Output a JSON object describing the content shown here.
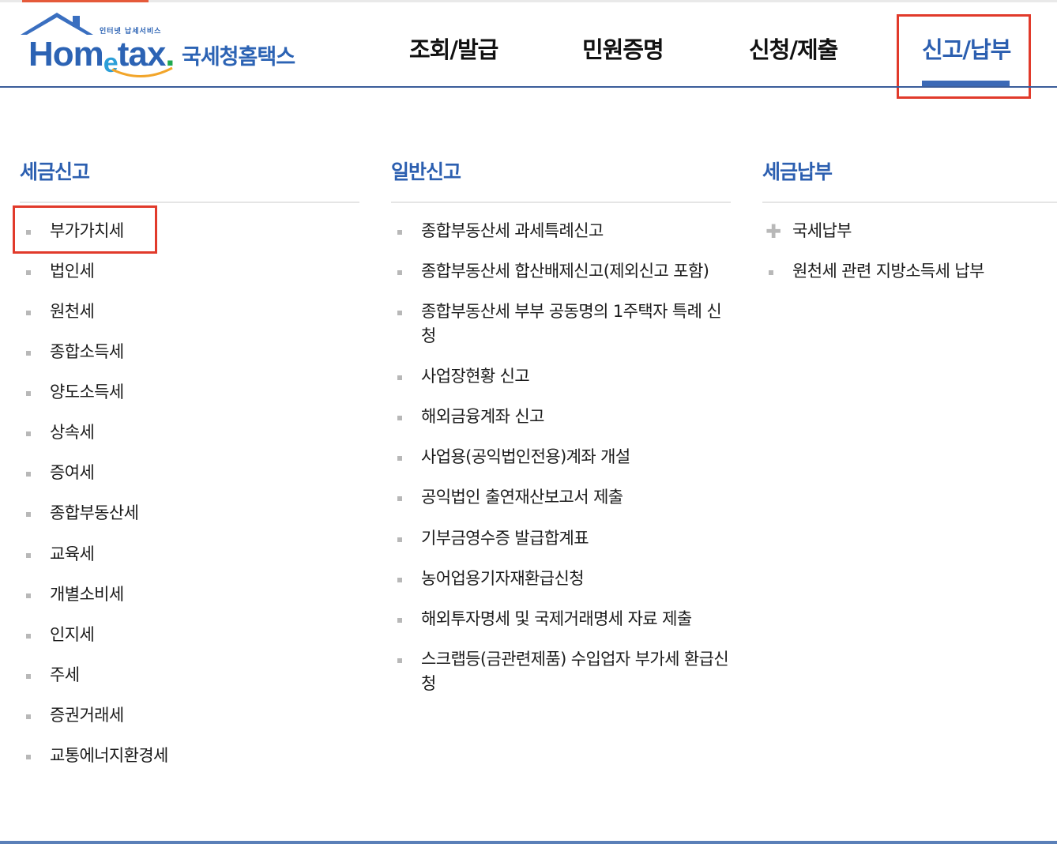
{
  "logo": {
    "small_text": "인터넷 납세서비스",
    "word_prefix": "Hom",
    "word_e": "e",
    "word_suffix": "tax",
    "word_dot": ".",
    "korean_name": "국세청홈택스"
  },
  "nav": {
    "items": [
      {
        "label": "조회/발급"
      },
      {
        "label": "민원증명"
      },
      {
        "label": "신청/제출"
      },
      {
        "label": "신고/납부"
      }
    ],
    "active_index": 3
  },
  "columns": [
    {
      "title": "세금신고",
      "items": [
        "부가가치세",
        "법인세",
        "원천세",
        "종합소득세",
        "양도소득세",
        "상속세",
        "증여세",
        "종합부동산세",
        "교육세",
        "개별소비세",
        "인지세",
        "주세",
        "증권거래세",
        "교통에너지환경세"
      ]
    },
    {
      "title": "일반신고",
      "items": [
        "종합부동산세 과세특례신고",
        "종합부동산세 합산배제신고(제외신고 포함)",
        "종합부동산세 부부 공동명의 1주택자 특례 신청",
        "사업장현황 신고",
        "해외금융계좌 신고",
        "사업용(공익법인전용)계좌 개설",
        "공익법인 출연재산보고서 제출",
        "기부금영수증 발급합계표",
        "농어업용기자재환급신청",
        "해외투자명세 및 국제거래명세 자료 제출",
        "스크랩등(금관련제품) 수입업자 부가세 환급신청"
      ]
    },
    {
      "title": "세금납부",
      "items": [
        "국세납부",
        "원천세 관련 지방소득세 납부"
      ]
    }
  ],
  "colors": {
    "brand_blue": "#2c5fb0",
    "highlight_red": "#e13a2b",
    "bullet_gray": "#b8b8b8"
  },
  "icons": {
    "list_bullet": "square-bullet-icon",
    "expand": "plus-icon"
  }
}
